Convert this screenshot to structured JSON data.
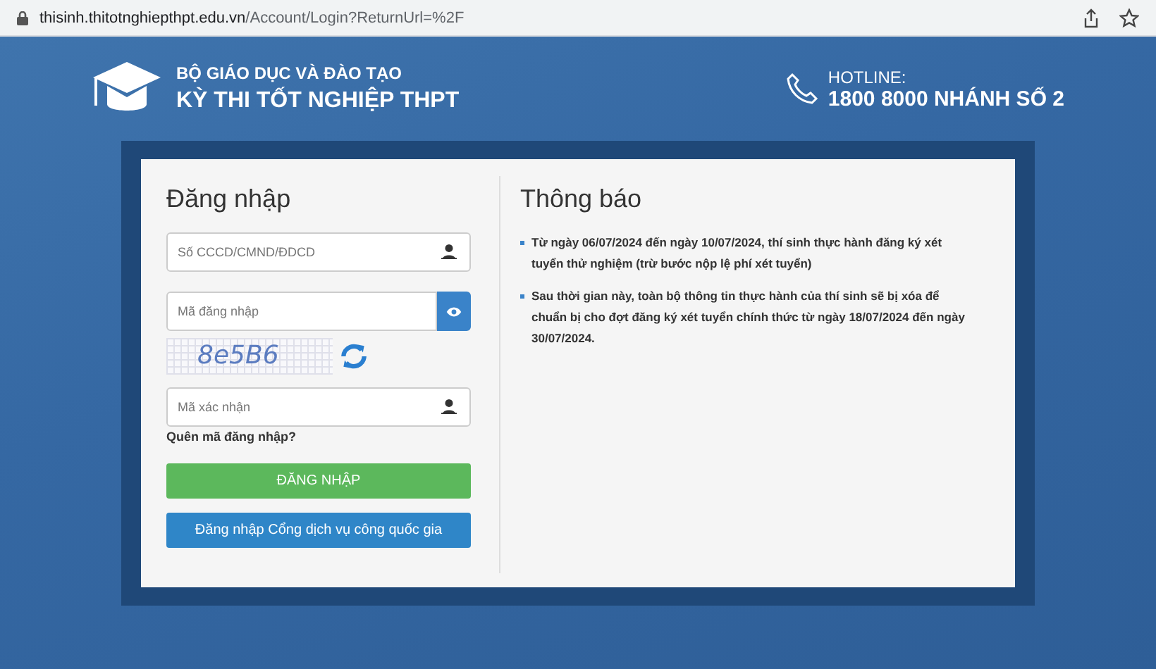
{
  "browser": {
    "url_host": "thisinh.thitotnghiepthpt.edu.vn",
    "url_path": "/Account/Login?ReturnUrl=%2F"
  },
  "header": {
    "ministry": "BỘ GIÁO DỤC VÀ ĐÀO TẠO",
    "exam": "KỲ THI TỐT NGHIỆP THPT",
    "hotline_label": "HOTLINE:",
    "hotline_number": "1800 8000 NHÁNH SỐ 2"
  },
  "login": {
    "title": "Đăng nhập",
    "fields": [
      {
        "kind": "user",
        "placeholder": "Số CCCD/CMND/ĐDCD"
      },
      {
        "kind": "password",
        "placeholder": "Mã đăng nhập"
      },
      {
        "kind": "captcha",
        "captcha": "8e5B6"
      },
      {
        "kind": "user",
        "placeholder": "Mã xác nhận"
      }
    ],
    "forgot_link": "Quên mã đăng nhập?",
    "buttons": [
      {
        "kind": "primary",
        "label": "ĐĂNG NHẬP"
      },
      {
        "kind": "secondary",
        "label": "Đăng nhập Cổng dịch vụ công quốc gia"
      }
    ]
  },
  "notices": {
    "title": "Thông báo",
    "items": [
      "Từ ngày 06/07/2024 đến ngày 10/07/2024, thí sinh thực hành đăng ký xét tuyển thử nghiệm (trừ bước nộp lệ phí xét tuyển)",
      "Sau thời gian này, toàn bộ thông tin thực hành của thí sinh sẽ bị xóa để chuẩn bị cho đợt đăng ký xét tuyển chính thức từ ngày 18/07/2024 đến ngày 30/07/2024."
    ]
  }
}
